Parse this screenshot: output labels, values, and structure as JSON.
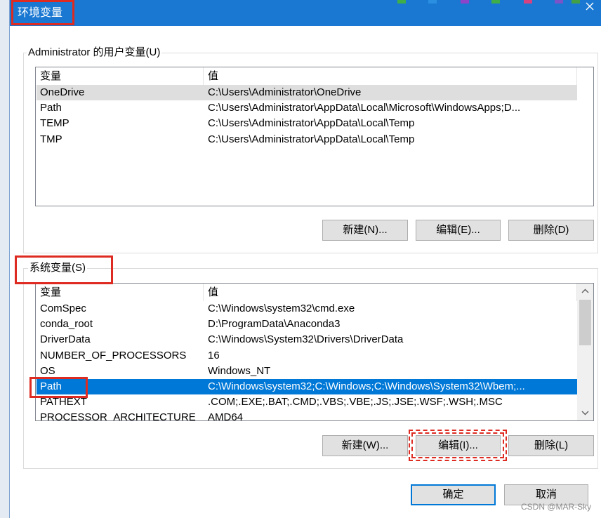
{
  "window": {
    "title": "环境变量",
    "close_icon": "close-icon"
  },
  "user_vars": {
    "label": "Administrator 的用户变量(U)",
    "columns": [
      "变量",
      "值"
    ],
    "rows": [
      {
        "name": "OneDrive",
        "value": "C:\\Users\\Administrator\\OneDrive"
      },
      {
        "name": "Path",
        "value": "C:\\Users\\Administrator\\AppData\\Local\\Microsoft\\WindowsApps;D..."
      },
      {
        "name": "TEMP",
        "value": "C:\\Users\\Administrator\\AppData\\Local\\Temp"
      },
      {
        "name": "TMP",
        "value": "C:\\Users\\Administrator\\AppData\\Local\\Temp"
      }
    ],
    "selected_index": 0,
    "selection_focused": false,
    "buttons": {
      "new": "新建(N)...",
      "edit": "编辑(E)...",
      "delete": "删除(D)"
    }
  },
  "system_vars": {
    "label": "系统变量(S)",
    "columns": [
      "变量",
      "值"
    ],
    "rows": [
      {
        "name": "ComSpec",
        "value": "C:\\Windows\\system32\\cmd.exe"
      },
      {
        "name": "conda_root",
        "value": "D:\\ProgramData\\Anaconda3"
      },
      {
        "name": "DriverData",
        "value": "C:\\Windows\\System32\\Drivers\\DriverData"
      },
      {
        "name": "NUMBER_OF_PROCESSORS",
        "value": "16"
      },
      {
        "name": "OS",
        "value": "Windows_NT"
      },
      {
        "name": "Path",
        "value": "C:\\Windows\\system32;C:\\Windows;C:\\Windows\\System32\\Wbem;..."
      },
      {
        "name": "PATHEXT",
        "value": ".COM;.EXE;.BAT;.CMD;.VBS;.VBE;.JS;.JSE;.WSF;.WSH;.MSC"
      },
      {
        "name": "PROCESSOR_ARCHITECTURE",
        "value": "AMD64"
      }
    ],
    "selected_index": 5,
    "selection_focused": true,
    "scroll_icons": {
      "up": "chevron-up-icon",
      "down": "chevron-down-icon"
    },
    "buttons": {
      "new": "新建(W)...",
      "edit": "编辑(I)...",
      "delete": "删除(L)"
    }
  },
  "footer": {
    "ok": "确定",
    "cancel": "取消"
  },
  "watermark": "CSDN @MAR-Sky",
  "colors": {
    "title_bar": "#1a78d2",
    "selection": "#0078d7",
    "inactive_selection": "#dedede",
    "annotation": "#de2b22",
    "default_button_border": "#0078d7"
  }
}
